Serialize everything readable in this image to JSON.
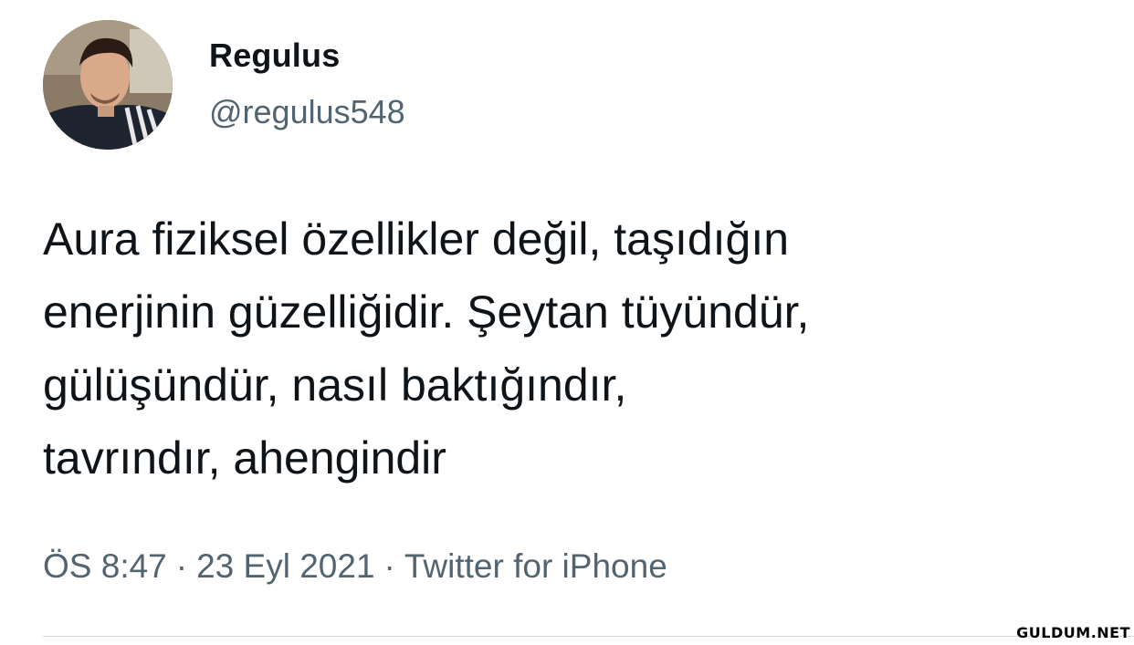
{
  "author": {
    "display_name": "Regulus",
    "handle": "@regulus548",
    "avatar_icon": "profile-photo-avatar"
  },
  "tweet": {
    "lines": [
      "Aura fiziksel özellikler değil, taşıdığın",
      "enerjinin güzelliğidir. Şeytan tüyündür,",
      "gülüşündür, nasıl baktığındır,",
      "tavrındır, ahengindir"
    ]
  },
  "meta": {
    "time": "ÖS 8:47",
    "separator": "·",
    "date": "23 Eyl 2021",
    "source": "Twitter for iPhone"
  },
  "watermark": "GULDUM.NET",
  "colors": {
    "text_primary": "#0f1419",
    "text_secondary": "#536471",
    "divider": "#cfd9de"
  }
}
